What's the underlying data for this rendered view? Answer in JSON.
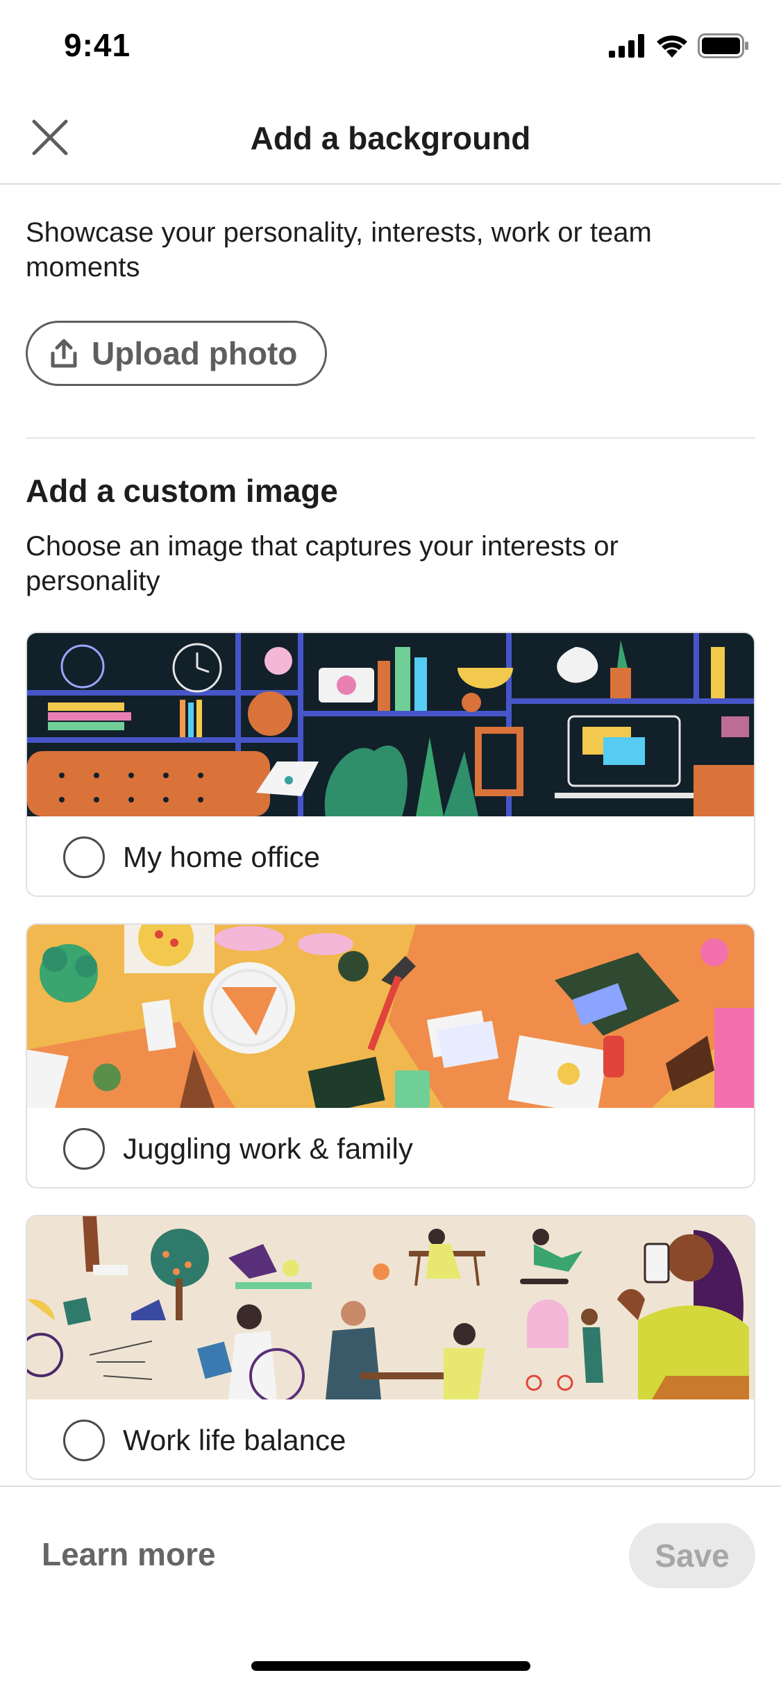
{
  "status_bar": {
    "time": "9:41"
  },
  "header": {
    "title": "Add a background"
  },
  "intro": {
    "text": "Showcase your personality, interests, work or team moments",
    "upload_label": "Upload photo"
  },
  "section": {
    "title": "Add a custom image",
    "subtitle": "Choose an image that captures your interests or personality"
  },
  "options": [
    {
      "label": "My home office",
      "selected": false
    },
    {
      "label": "Juggling work & family",
      "selected": false
    },
    {
      "label": "Work life balance",
      "selected": false
    }
  ],
  "footer": {
    "learn_more": "Learn more",
    "save": "Save"
  },
  "colors": {
    "primary_text": "#1d1d1d",
    "muted_text": "#666666",
    "save_disabled_bg": "#e9e9e9",
    "office_bg": "#12202a",
    "family_bg": "#f0b84e",
    "balance_bg": "#efe4d3"
  }
}
